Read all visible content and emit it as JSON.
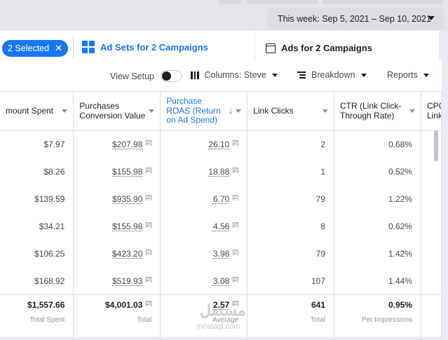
{
  "date_range": {
    "label": "This week: Sep 5, 2021 – Sep 10, 2021"
  },
  "tabs": {
    "selected_chip": "2 Selected",
    "selected_close": "✕",
    "ad_sets": "Ad Sets for 2 Campaigns",
    "ads": "Ads for 2 Campaigns"
  },
  "toolbar": {
    "view_setup": "View Setup",
    "columns": "Columns: Steve",
    "breakdown": "Breakdown",
    "reports": "Reports"
  },
  "table": {
    "headers": [
      "mount Spent",
      "Purchases Conversion Value",
      "Purchase ROAS (Return on Ad Spend)",
      "Link Clicks",
      "CTR (Link Click-Through Rate)",
      "CPC Link"
    ],
    "sort_arrow": "↓",
    "rows": [
      {
        "spent": "$7.97",
        "value": "$207.98",
        "roas": "26.10",
        "clicks": "2",
        "ctr": "0.68%"
      },
      {
        "spent": "$8.26",
        "value": "$155.98",
        "roas": "18.88",
        "clicks": "1",
        "ctr": "0.52%"
      },
      {
        "spent": "$139.59",
        "value": "$935.90",
        "roas": "6.70",
        "clicks": "79",
        "ctr": "1.22%"
      },
      {
        "spent": "$34.21",
        "value": "$155.98",
        "roas": "4.56",
        "clicks": "8",
        "ctr": "0.62%"
      },
      {
        "spent": "$106.25",
        "value": "$423.20",
        "roas": "3.98",
        "clicks": "79",
        "ctr": "1.42%"
      },
      {
        "spent": "$168.92",
        "value": "$519.93",
        "roas": "3.08",
        "clicks": "107",
        "ctr": "1.44%"
      }
    ],
    "sup": "[2]",
    "totals": {
      "spent": "$1,557.66",
      "spent_label": "Total Spent",
      "value": "$4,001.03",
      "value_label": "Total",
      "roas": "2.57",
      "roas_label": "Average",
      "clicks": "641",
      "clicks_label": "Total",
      "ctr": "0.95%",
      "ctr_label": "Per Impressions"
    }
  },
  "watermark": {
    "text": "مستقل",
    "sub": "mostaql.com"
  }
}
